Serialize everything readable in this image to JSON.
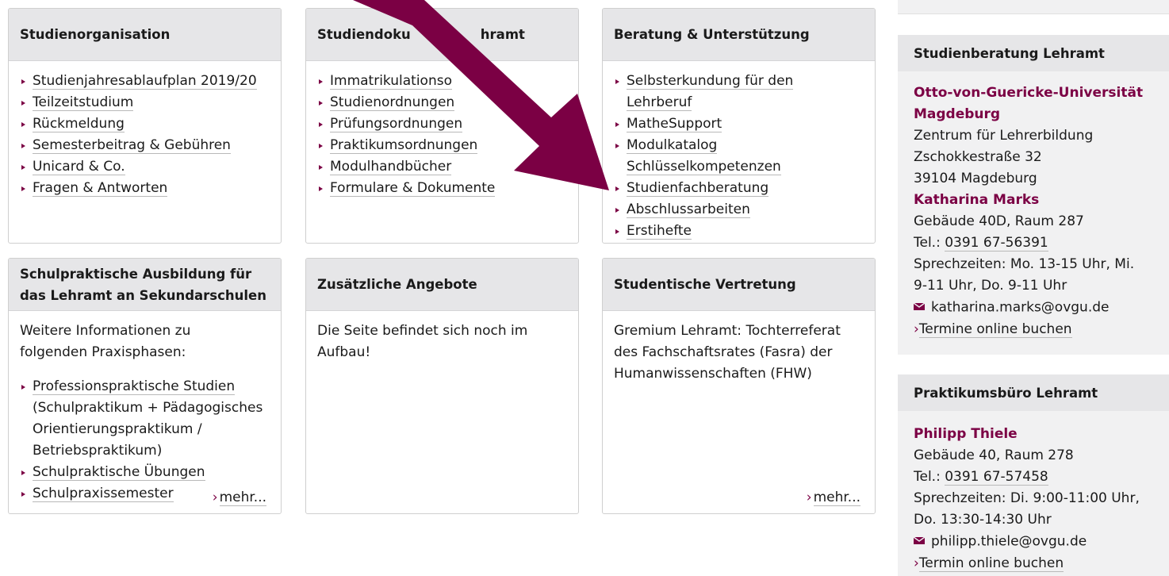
{
  "cards": {
    "studienorganisation": {
      "title": "Studienorganisation",
      "links": [
        "Studienjahresablaufplan 2019/20",
        "Teilzeitstudium",
        "Rückmeldung",
        "Semesterbeitrag & Gebühren",
        "Unicard & Co.",
        "Fragen & Antworten"
      ]
    },
    "studiendokumente": {
      "title": "Studiendokumente Lehramt",
      "title_left": "Studiendoku",
      "title_right": "hramt",
      "links": [
        "Immatrikulationsordnung",
        "Studienordnungen",
        "Prüfungsordnungen",
        "Praktikumsordnungen",
        "Modulhandbücher",
        "Formulare & Dokumente"
      ],
      "first_link_visible": "Immatrikulationso"
    },
    "beratung": {
      "title": "Beratung & Unterstützung",
      "links": [
        "Selbsterkundung für den",
        "Lehrberuf",
        "MatheSupport",
        "Modulkatalog",
        "Schlüsselkompetenzen",
        "Studienfachberatung",
        "Abschlussarbeiten",
        "Erstihefte"
      ]
    },
    "schulpraktische": {
      "title_line1": "Schulpraktische Ausbildung für",
      "title_line2": "das Lehramt an Sekundarschulen",
      "intro_line1": "Weitere Informationen zu",
      "intro_line2": "folgenden Praxisphasen:",
      "links": [
        "Professionspraktische Studien",
        "(Schulpraktikum + Pädagogisches",
        "Orientierungspraktikum /",
        "Betriebspraktikum)",
        "Schulpraktische Übungen",
        "Schulpraxissemester"
      ],
      "more": "mehr..."
    },
    "zusaetzlich": {
      "title": "Zusätzliche Angebote",
      "text_line1": "Die Seite befindet sich noch im",
      "text_line2": "Aufbau!"
    },
    "vertretung": {
      "title": "Studentische Vertretung",
      "text_line1": "Gremium Lehramt: Tochterreferat",
      "text_line2": "des Fachschaftsrates (Fasra) der",
      "text_line3": "Humanwissenschaften (FHW)",
      "more": "mehr..."
    }
  },
  "sidebar": {
    "studienberatung": {
      "title": "Studienberatung Lehramt",
      "org_line1": "Otto-von-Guericke-Universität",
      "org_line2": "Magdeburg",
      "unit": "Zentrum für Lehrerbildung",
      "street": "Zschokkestraße 32",
      "city": "39104 Magdeburg",
      "person": "Katharina Marks",
      "room": "Gebäude 40D, Raum 287",
      "tel_label": "Tel.:",
      "tel": "0391 67-56391",
      "hours_line1": "Sprechzeiten: Mo. 13-15 Uhr, Mi.",
      "hours_line2": "9-11 Uhr, Do. 9-11 Uhr",
      "email": "katharina.marks@ovgu.de",
      "booking": "Termine online buchen"
    },
    "praktikumsbuero": {
      "title": "Praktikumsbüro Lehramt",
      "person": "Philipp Thiele",
      "room": "Gebäude 40, Raum 278",
      "tel_label": "Tel.:",
      "tel": "0391 67-57458",
      "hours_line1": "Sprechzeiten: Di. 9:00-11:00 Uhr,",
      "hours_line2": "Do. 13:30-14:30 Uhr",
      "email": "philipp.thiele@ovgu.de",
      "booking": "Termin online buchen"
    }
  },
  "icons": {
    "bullet": "triangle-bullet-icon",
    "mail": "envelope-icon",
    "chevron": "chevron-right-icon",
    "annotation": "annotation-arrow-icon"
  },
  "colors": {
    "accent": "#7b0044",
    "header_bg": "#e6e6e8",
    "sidebar_bg": "#f1f1f2"
  }
}
